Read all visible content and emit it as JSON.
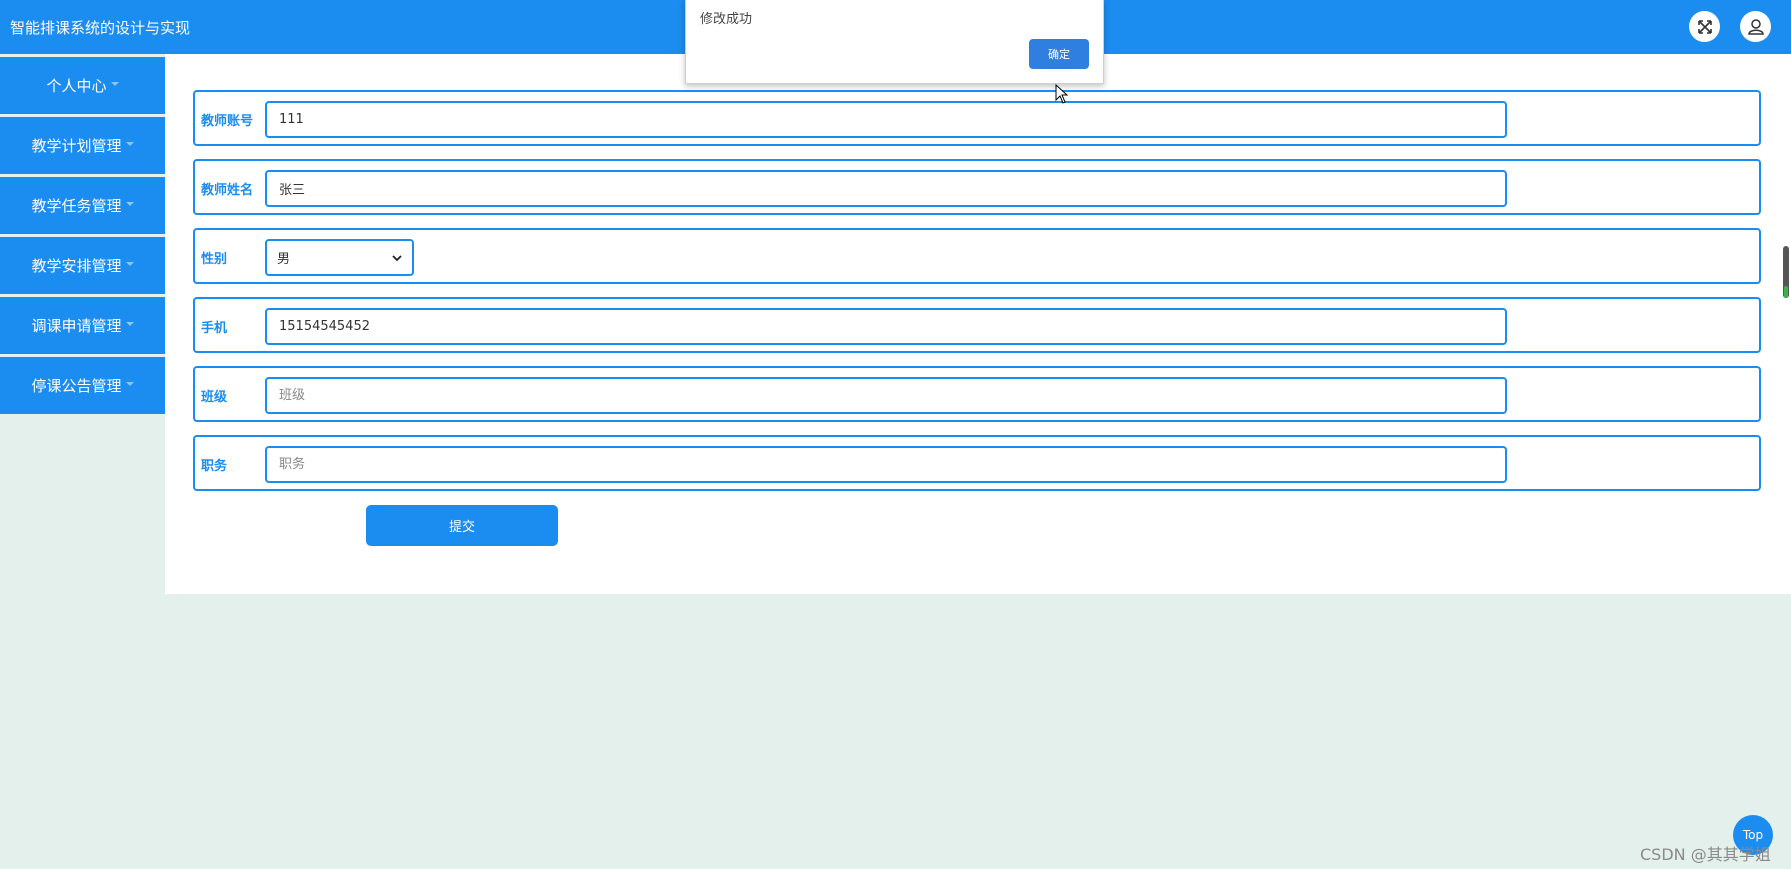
{
  "header": {
    "title": "智能排课系统的设计与实现",
    "fullscreen_icon": "expand-icon",
    "user_icon": "user-icon",
    "color": "#1b8df0"
  },
  "sidebar": {
    "items": [
      {
        "label": "个人中心"
      },
      {
        "label": "教学计划管理"
      },
      {
        "label": "教学任务管理"
      },
      {
        "label": "教学安排管理"
      },
      {
        "label": "调课申请管理"
      },
      {
        "label": "停课公告管理"
      }
    ]
  },
  "form": {
    "account": {
      "label": "教师账号",
      "value": "111"
    },
    "name": {
      "label": "教师姓名",
      "value": "张三"
    },
    "gender": {
      "label": "性别",
      "value": "男"
    },
    "phone": {
      "label": "手机",
      "value": "15154545452"
    },
    "class": {
      "label": "班级",
      "placeholder": "班级"
    },
    "duty": {
      "label": "职务",
      "placeholder": "职务"
    },
    "submit_label": "提交"
  },
  "dialog": {
    "message": "修改成功",
    "ok_label": "确定"
  },
  "back_to_top": "Top",
  "watermark": "CSDN @其其学姐"
}
